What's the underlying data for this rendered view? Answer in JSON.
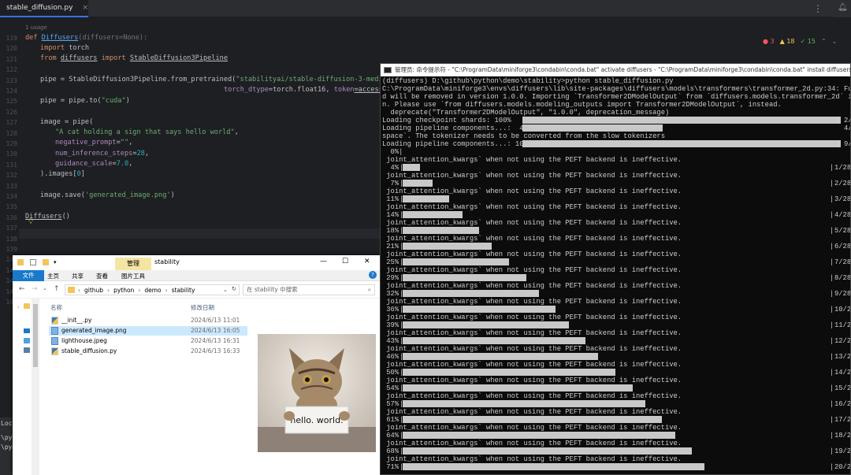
{
  "ide": {
    "tab_label": "stable_diffusion.py",
    "usage_hint": "1 usage",
    "inspections": {
      "errors": "3",
      "warnings": "18",
      "ok": "15"
    },
    "line_numbers": [
      "119",
      "120",
      "121",
      "122",
      "123",
      "124",
      "125",
      "126",
      "127",
      "128",
      "129",
      "130",
      "131",
      "132",
      "133",
      "134",
      "135",
      "136",
      "137",
      "138",
      "139",
      "140",
      "141",
      "142",
      "143",
      "144"
    ],
    "code": {
      "l119_kw": "def ",
      "l119_fn": "Diffusers",
      "l119_rest": "(diffusers=None):",
      "l120_kw": "import ",
      "l120_rest": "torch",
      "l121_kw1": "from ",
      "l121_mod": "diffusers",
      "l121_kw2": " import ",
      "l121_cls": "StableDiffusion3Pipeline",
      "l123_a": "pipe = StableDiffusion3Pipeline.from_pretrained(",
      "l123_str": "\"stabilityai/stable-diffusion-3-medium-di",
      "l124_a": "torch_dtype",
      "l124_b": "=torch.float16, ",
      "l124_c": "token",
      "l124_d": "=access_t",
      "l126_a": "pipe = pipe.to(",
      "l126_str": "\"cuda\"",
      "l126_b": ")",
      "l128_a": "image = pipe(",
      "l129_str": "\"A cat holding a sign that says hello world\"",
      "l129_b": ",",
      "l130_p": "negative_prompt",
      "l130_b": "=",
      "l130_str": "\"\"",
      "l130_c": ",",
      "l131_p": "num_inference_steps",
      "l131_b": "=",
      "l131_n": "28",
      "l131_c": ",",
      "l132_p": "guidance_scale",
      "l132_b": "=",
      "l132_n": "7.0",
      "l132_c": ",",
      "l133_a": ").images[",
      "l133_n": "0",
      "l133_b": "]",
      "l135_a": "image.save(",
      "l135_str": "'generated_image.png'",
      "l135_b": ")",
      "l137_a": "Diffusers",
      "l137_b": "()"
    },
    "bottom_left": [
      "Loca",
      "\\py",
      "\\py"
    ]
  },
  "explorer": {
    "manage_tab": "管理",
    "title": "stability",
    "ribbon_tabs": [
      "文件",
      "主页",
      "共享",
      "查看",
      "图片工具"
    ],
    "breadcrumb": [
      "github",
      "python",
      "demo",
      "stability"
    ],
    "search_placeholder": "在 stability 中搜索",
    "col_name": "名称",
    "col_date": "修改日期",
    "files": [
      {
        "name": "__init__.py",
        "date": "2024/6/13 11:01"
      },
      {
        "name": "generated_image.png",
        "date": "2024/6/13 16:05"
      },
      {
        "name": "lighthouse.jpeg",
        "date": "2024/6/13 16:31"
      },
      {
        "name": "stable_diffusion.py",
        "date": "2024/6/13 16:33"
      }
    ],
    "preview_sign": "hello. world."
  },
  "console": {
    "title": "管理员: 命令提示符 - \"C:\\ProgramData\\miniforge3\\condabin\\conda.bat\"  activate diffusers - \"C:\\ProgramData\\miniforge3\\condabin\\conda.bat\"  install diffusers - \"C:\\Prog",
    "lines": [
      "(diffusers) D:\\github\\python\\demo\\stability>python stable_diffusion.py",
      "C:\\ProgramData\\miniforge3\\envs\\diffusers\\lib\\site-packages\\diffusers\\models\\transformers\\transformer_2d.py:34: FutureWarnin",
      "d will be removed in version 1.0.0. Importing `Transformer2DModelOutput` from `diffusers.models.transformer_2d` is deprecat",
      "n. Please use `from diffusers.models.modeling_outputs import Transformer2DModelOutput`, instead.",
      "  deprecate(\"Transformer2DModelOutput\", \"1.0.0\", deprecation_message)"
    ],
    "load_shards_label": "Loading checkpoint shards: 100%",
    "load_shards_right": "2/",
    "load_comp1_label": "Loading pipeline components...:  44%",
    "load_comp1_right": "4/",
    "tokenizer_msg": "space`. The tokenizer needs to be converted from the slow tokenizers",
    "load_comp2_label": "Loading pipeline components...: 100%",
    "load_comp2_right": "9/",
    "zero_pct": "  0%|",
    "warn_msg": " joint_attention_kwargs` when not using the PEFT backend is ineffective.",
    "steps": [
      {
        "pct": "  4%",
        "count": "1/28",
        "progress": 0.04
      },
      {
        "pct": "  7%",
        "count": "2/28",
        "progress": 0.07
      },
      {
        "pct": " 11%",
        "count": "3/28",
        "progress": 0.11
      },
      {
        "pct": " 14%",
        "count": "4/28",
        "progress": 0.14
      },
      {
        "pct": " 18%",
        "count": "5/28",
        "progress": 0.18
      },
      {
        "pct": " 21%",
        "count": "6/28",
        "progress": 0.21
      },
      {
        "pct": " 25%",
        "count": "7/28",
        "progress": 0.25
      },
      {
        "pct": " 29%",
        "count": "8/28",
        "progress": 0.29
      },
      {
        "pct": " 32%",
        "count": "9/28",
        "progress": 0.32
      },
      {
        "pct": " 36%",
        "count": "10/28",
        "progress": 0.36
      },
      {
        "pct": " 39%",
        "count": "11/28",
        "progress": 0.39
      },
      {
        "pct": " 43%",
        "count": "12/28",
        "progress": 0.43
      },
      {
        "pct": " 46%",
        "count": "13/28",
        "progress": 0.46
      },
      {
        "pct": " 50%",
        "count": "14/28",
        "progress": 0.5
      },
      {
        "pct": " 54%",
        "count": "15/28",
        "progress": 0.54
      },
      {
        "pct": " 57%",
        "count": "16/28",
        "progress": 0.57
      },
      {
        "pct": " 61%",
        "count": "17/28",
        "progress": 0.61
      },
      {
        "pct": " 64%",
        "count": "18/28",
        "progress": 0.64
      },
      {
        "pct": " 68%",
        "count": "19/28",
        "progress": 0.68
      },
      {
        "pct": " 71%",
        "count": "20/28",
        "progress": 0.71
      }
    ]
  }
}
